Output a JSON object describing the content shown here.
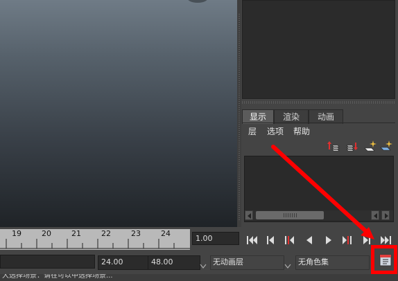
{
  "channel_panel": {
    "tabs": [
      {
        "label": "显示"
      },
      {
        "label": "渲染"
      },
      {
        "label": "动画"
      }
    ],
    "menus": [
      {
        "label": "层"
      },
      {
        "label": "选项"
      },
      {
        "label": "帮助"
      }
    ],
    "layer_icons": [
      "new-layer-up-icon",
      "new-layer-down-icon",
      "new-layer-selected-icon",
      "new-empty-layer-icon"
    ]
  },
  "time_slider": {
    "tick_labels": [
      "19",
      "20",
      "21",
      "22",
      "23",
      "24"
    ],
    "current_frame": "1.00"
  },
  "playback_controls": [
    "go-to-start-icon",
    "step-back-key-icon",
    "step-back-frame-icon",
    "play-backward-icon",
    "play-forward-icon",
    "step-forward-frame-icon",
    "step-forward-key-icon",
    "go-to-end-icon"
  ],
  "range_slider": {
    "playback_end": "24.00",
    "animation_end": "48.00",
    "anim_layer": "无动画层",
    "character_set": "无角色集"
  },
  "status_bar": {
    "text": "大选择场景：请在可以中选择场景..."
  },
  "colors": {
    "annotation": "#ff0000",
    "panel_bg": "#444444",
    "ruler_bg": "#b9b9b9"
  }
}
